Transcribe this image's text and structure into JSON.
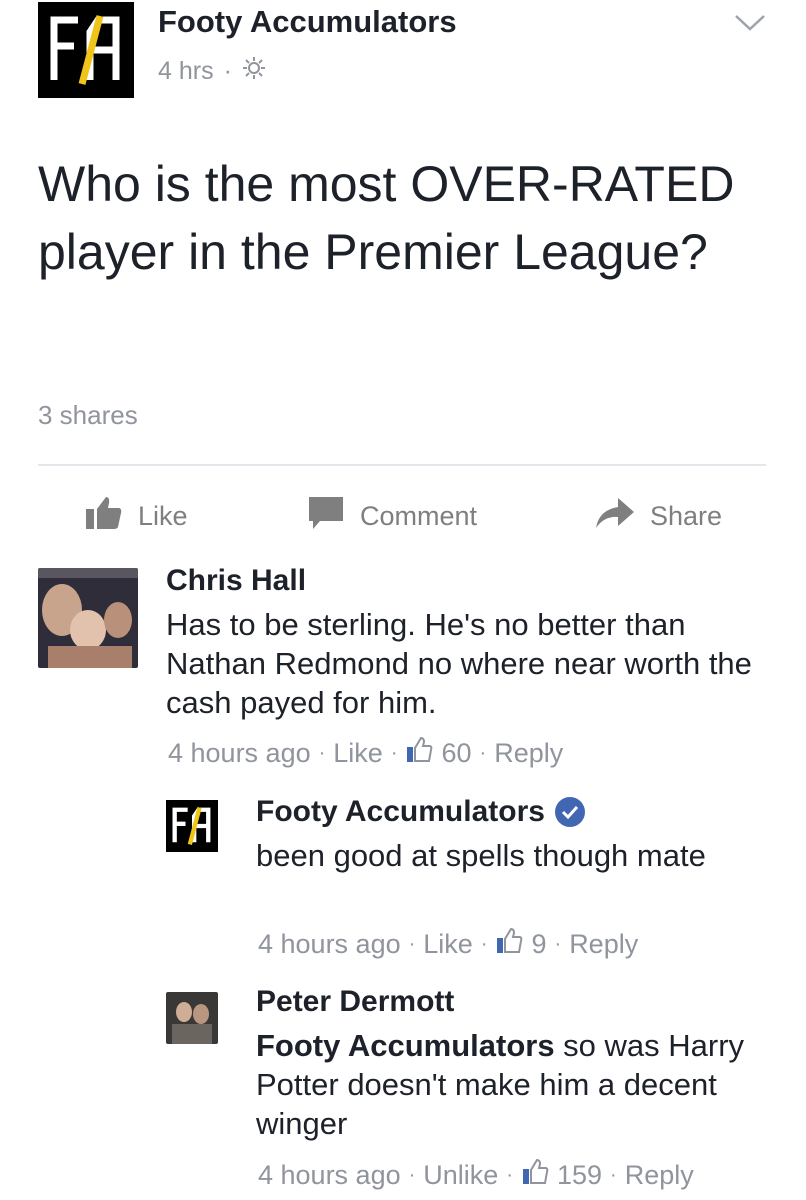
{
  "post": {
    "page_name": "Footy Accumulators",
    "time": "4 hrs",
    "meta_separator": "·",
    "privacy_icon": "globe-icon",
    "logo_text": "FA",
    "text": "Who is the most OVER-RATED player in the Premier League?",
    "shares": "3 shares"
  },
  "actions": {
    "like_label": "Like",
    "comment_label": "Comment",
    "share_label": "Share"
  },
  "comments": [
    {
      "author": "Chris Hall",
      "text": "Has to be sterling. He's no better than Nathan Redmond no where near worth the cash payed for him.",
      "time": "4 hours ago",
      "like_label": "Like",
      "likes": "60",
      "reply_label": "Reply"
    },
    {
      "author": "Footy Accumulators",
      "verified": true,
      "text": "been good at spells though mate",
      "time": "4 hours ago",
      "like_label": "Like",
      "likes": "9",
      "reply_label": "Reply"
    },
    {
      "author": "Peter Dermott",
      "tag": "Footy Accumulators",
      "text": " so was Harry Potter doesn't make him a decent winger",
      "time": "4 hours ago",
      "like_label": "Unlike",
      "likes": "159",
      "reply_label": "Reply"
    }
  ],
  "colors": {
    "text": "#1d2129",
    "meta": "#90949c",
    "like_blue": "#4267b2",
    "divider": "#e4e6eb"
  }
}
